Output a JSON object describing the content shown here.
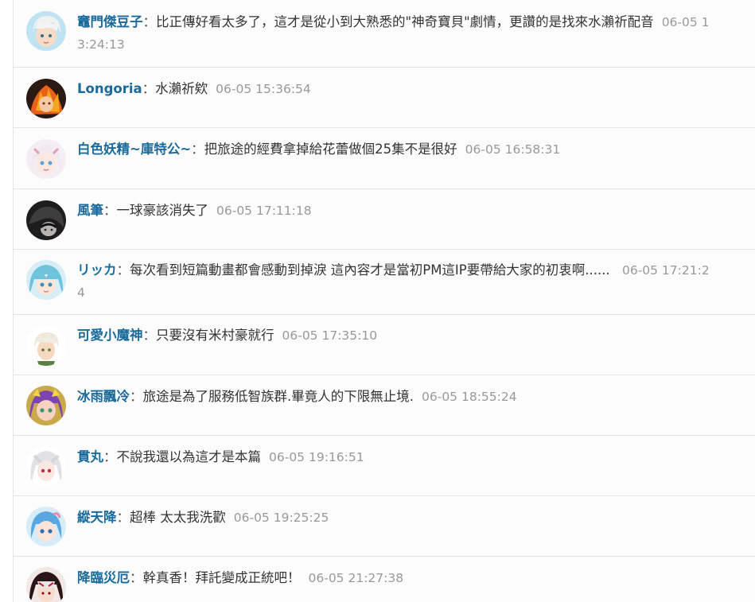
{
  "comments": [
    {
      "name": "竈門傑豆子",
      "sep": "：",
      "text": "比正傳好看太多了，這才是從小到大熟悉的\"神奇寶貝\"劇情，更讚的是找來水瀨祈配音",
      "time": "06-05 13:24:13",
      "avatar_color": "#7ab8d6"
    },
    {
      "name": "Longoria",
      "sep": "：",
      "text": "水瀨祈欸",
      "time": "06-05 15:36:54",
      "avatar_color": "#d9541e"
    },
    {
      "name": "白色妖精~庫特公~",
      "sep": "：",
      "text": "把旅途的經費拿掉給花蕾做個25集不是很好",
      "time": "06-05 16:58:31",
      "avatar_color": "#e8d6de"
    },
    {
      "name": "風筆",
      "sep": "：",
      "text": "一球豪該消失了",
      "time": "06-05 17:11:18",
      "avatar_color": "#2a2a2a"
    },
    {
      "name": "リッカ",
      "sep": "：",
      "text": "每次看到短篇動畫都會感動到掉淚 這內容才是當初PM這IP要帶給大家的初衷啊...... ",
      "time": "06-05 17:21:24",
      "avatar_color": "#6fbcd9"
    },
    {
      "name": "可愛小魔神",
      "sep": "：",
      "text": "只要沒有米村豪就行",
      "time": "06-05 17:35:10",
      "avatar_color": "#e9dcc8"
    },
    {
      "name": "冰雨飄冷",
      "sep": "：",
      "text": "旅途是為了服務低智族群.畢竟人的下限無止境.",
      "time": "06-05 18:55:24",
      "avatar_color": "#7a4aa8"
    },
    {
      "name": "貫丸",
      "sep": "：",
      "text": "不說我還以為這才是本篇",
      "time": "06-05 19:16:51",
      "avatar_color": "#d8d8dc"
    },
    {
      "name": "縱天降",
      "sep": "：",
      "text": "超棒 太太我洗歡",
      "time": "06-05 19:25:25",
      "avatar_color": "#5aa6df"
    },
    {
      "name": "降臨災厄",
      "sep": "：",
      "text": "幹真香！拜託變成正統吧！",
      "time": "06-05 21:27:38",
      "avatar_color": "#3a1e22"
    }
  ]
}
